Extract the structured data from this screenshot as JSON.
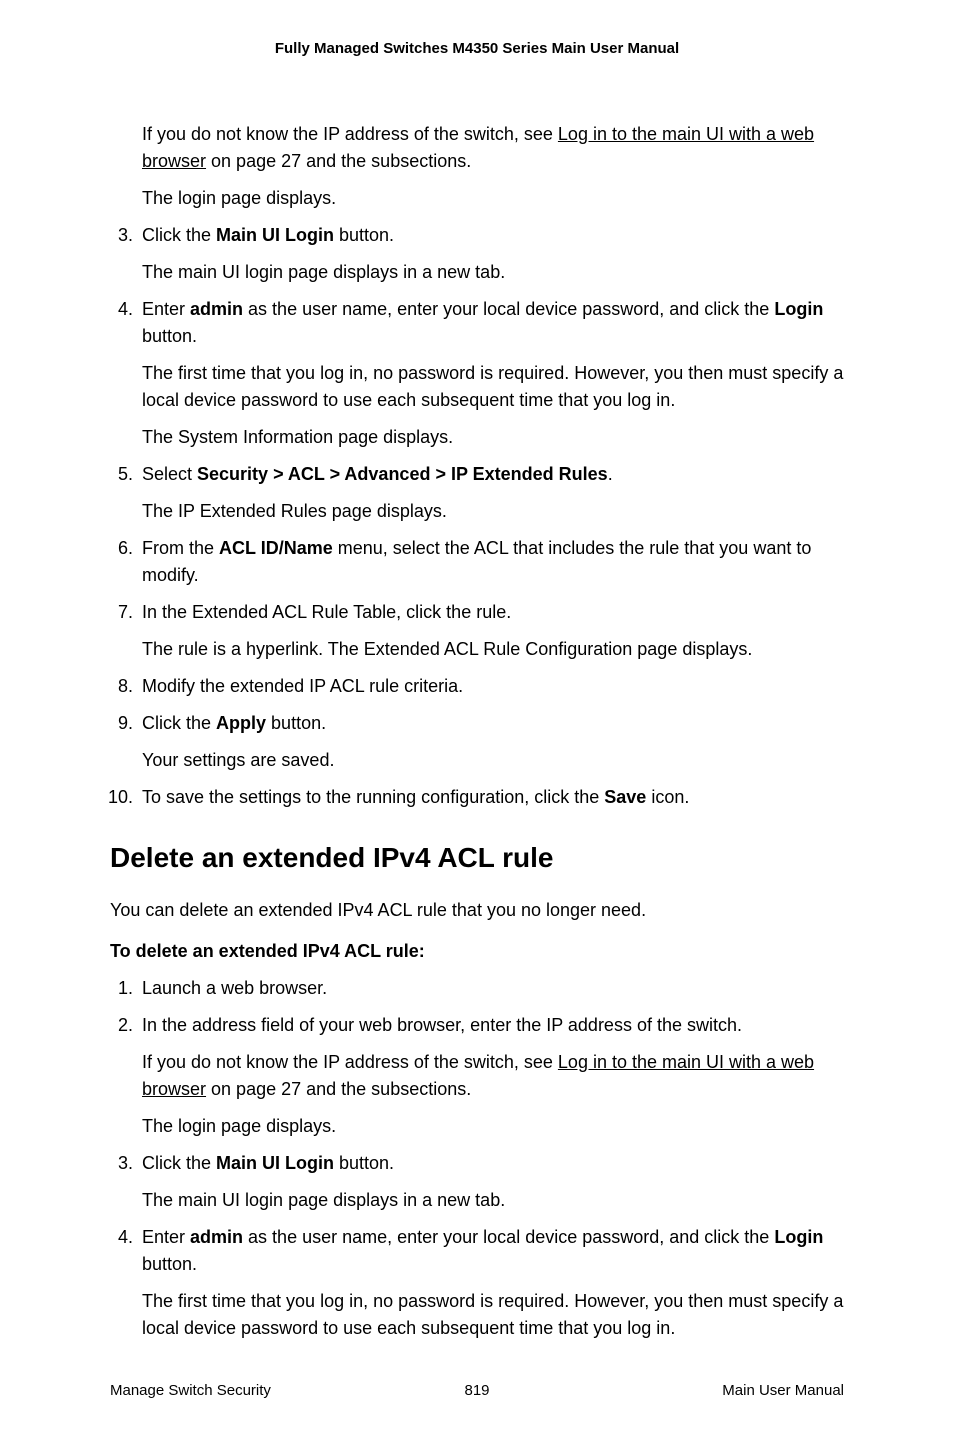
{
  "header": {
    "title": "Fully Managed Switches M4350 Series Main User Manual"
  },
  "section1": {
    "preamble": {
      "p1_pre": "If you do not know the IP address of the switch, see ",
      "p1_link": "Log in to the main UI with a web browser",
      "p1_post": " on page 27 and the subsections.",
      "p2": "The login page displays."
    },
    "steps": {
      "s3": {
        "line1_pre": "Click the ",
        "line1_bold": "Main UI Login",
        "line1_post": " button.",
        "p1": "The main UI login page displays in a new tab."
      },
      "s4": {
        "line1_pre": "Enter ",
        "line1_bold1": "admin",
        "line1_mid": " as the user name, enter your local device password, and click the ",
        "line1_bold2": "Login",
        "line1_post": " button.",
        "p1": "The first time that you log in, no password is required. However, you then must specify a local device password to use each subsequent time that you log in.",
        "p2": "The System Information page displays."
      },
      "s5": {
        "line1_pre": "Select ",
        "line1_bold": "Security > ACL > Advanced > IP Extended Rules",
        "line1_post": ".",
        "p1": "The IP Extended Rules page displays."
      },
      "s6": {
        "line1_pre": "From the ",
        "line1_bold": "ACL ID/Name",
        "line1_post": " menu, select the ACL that includes the rule that you want to modify."
      },
      "s7": {
        "line1": "In the Extended ACL Rule Table, click the rule.",
        "p1": "The rule is a hyperlink. The Extended ACL Rule Configuration page displays."
      },
      "s8": {
        "line1": "Modify the extended IP ACL rule criteria."
      },
      "s9": {
        "line1_pre": "Click the ",
        "line1_bold": "Apply",
        "line1_post": " button.",
        "p1": "Your settings are saved."
      },
      "s10": {
        "line1_pre": "To save the settings to the running configuration, click the ",
        "line1_bold": "Save",
        "line1_post": " icon."
      }
    }
  },
  "section2": {
    "heading": "Delete an extended IPv4 ACL rule",
    "intro": "You can delete an extended IPv4 ACL rule that you no longer need.",
    "subheading": "To delete an extended IPv4 ACL rule:",
    "steps": {
      "s1": {
        "line1": "Launch a web browser."
      },
      "s2": {
        "line1": "In the address field of your web browser, enter the IP address of the switch.",
        "p1_pre": "If you do not know the IP address of the switch, see ",
        "p1_link": "Log in to the main UI with a web browser",
        "p1_post": " on page 27 and the subsections.",
        "p2": "The login page displays."
      },
      "s3": {
        "line1_pre": "Click the ",
        "line1_bold": "Main UI Login",
        "line1_post": " button.",
        "p1": "The main UI login page displays in a new tab."
      },
      "s4": {
        "line1_pre": "Enter ",
        "line1_bold1": "admin",
        "line1_mid": " as the user name, enter your local device password, and click the ",
        "line1_bold2": "Login",
        "line1_post": " button.",
        "p1": "The first time that you log in, no password is required. However, you then must specify a local device password to use each subsequent time that you log in."
      }
    }
  },
  "footer": {
    "left": "Manage Switch Security",
    "center": "819",
    "right": "Main User Manual"
  }
}
